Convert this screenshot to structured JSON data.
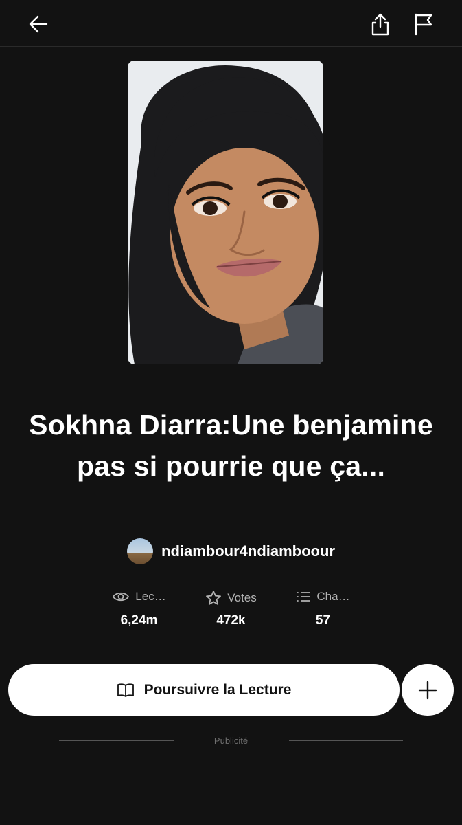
{
  "toolbar": {
    "back_icon": "arrow-left-icon",
    "share_icon": "share-icon",
    "flag_icon": "flag-icon"
  },
  "story": {
    "title": "Sokhna Diarra:Une benjamine pas si pourrie que ça...",
    "author": "ndiambour4ndiamboour"
  },
  "stats": [
    {
      "icon": "eye-icon",
      "label": "Lec…",
      "value": "6,24m"
    },
    {
      "icon": "star-icon",
      "label": "Votes",
      "value": "472k"
    },
    {
      "icon": "list-icon",
      "label": "Cha…",
      "value": "57"
    }
  ],
  "actions": {
    "read_label": "Poursuivre la Lecture",
    "read_icon": "book-icon",
    "add_icon": "plus-icon"
  },
  "ad": {
    "label": "Publicité"
  },
  "colors": {
    "background": "#121212",
    "text": "#ffffff",
    "muted": "#b3b3b3",
    "button": "#ffffff"
  }
}
